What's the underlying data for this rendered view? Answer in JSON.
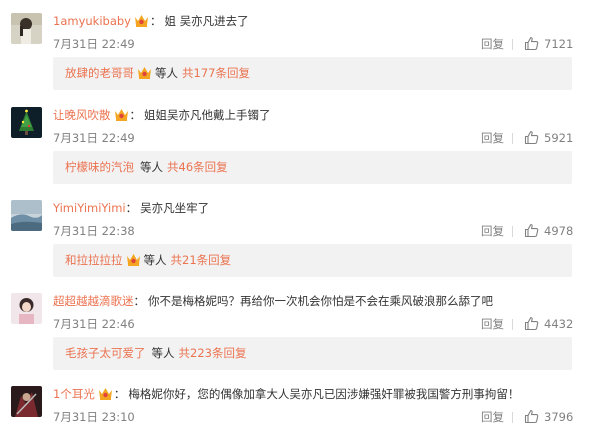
{
  "comments": [
    {
      "username": "1amyukibaby",
      "text": "姐 吴亦凡进去了",
      "time": "7月31日 22:49",
      "reply_label": "回复",
      "likes": "7121",
      "avatar_icon": "girl-photo-avatar",
      "replies": {
        "name": "放肆的老哥哥",
        "middle": "等人",
        "link": "共177条回复"
      }
    },
    {
      "username": "让晚风吹散",
      "text": "姐姐吴亦凡他戴上手镯了",
      "time": "7月31日 22:49",
      "reply_label": "回复",
      "likes": "5921",
      "avatar_icon": "christmas-tree-avatar",
      "replies": {
        "name": "柠檬味的汽泡",
        "middle": "等人",
        "link": "共46条回复"
      }
    },
    {
      "username": "YimiYimiYimi",
      "text": "吴亦凡坐牢了",
      "time": "7月31日 22:38",
      "reply_label": "回复",
      "likes": "4978",
      "avatar_icon": "landscape-avatar",
      "replies": {
        "name": "和拉拉拉拉",
        "middle": "等人",
        "link": "共21条回复"
      }
    },
    {
      "username": "超超越越滴歌迷",
      "text": "你不是梅格妮吗？再给你一次机会你怕是不会在乘风破浪那么舔了吧",
      "time": "7月31日 22:46",
      "reply_label": "回复",
      "likes": "4432",
      "avatar_icon": "portrait-avatar",
      "replies": {
        "name": "毛孩子太可爱了",
        "middle": "等人",
        "link": "共223条回复"
      }
    },
    {
      "username": "1个耳光",
      "text": "梅格妮你好，您的偶像加拿大人吴亦凡已因涉嫌强奸罪被我国警方刑事拘留！",
      "time": "7月31日 23:10",
      "reply_label": "回复",
      "likes": "3796",
      "avatar_icon": "dark-figure-avatar"
    }
  ],
  "colors": {
    "accent": "#eb7350",
    "muted": "#808080",
    "reply_bg": "#f2f2f2"
  }
}
